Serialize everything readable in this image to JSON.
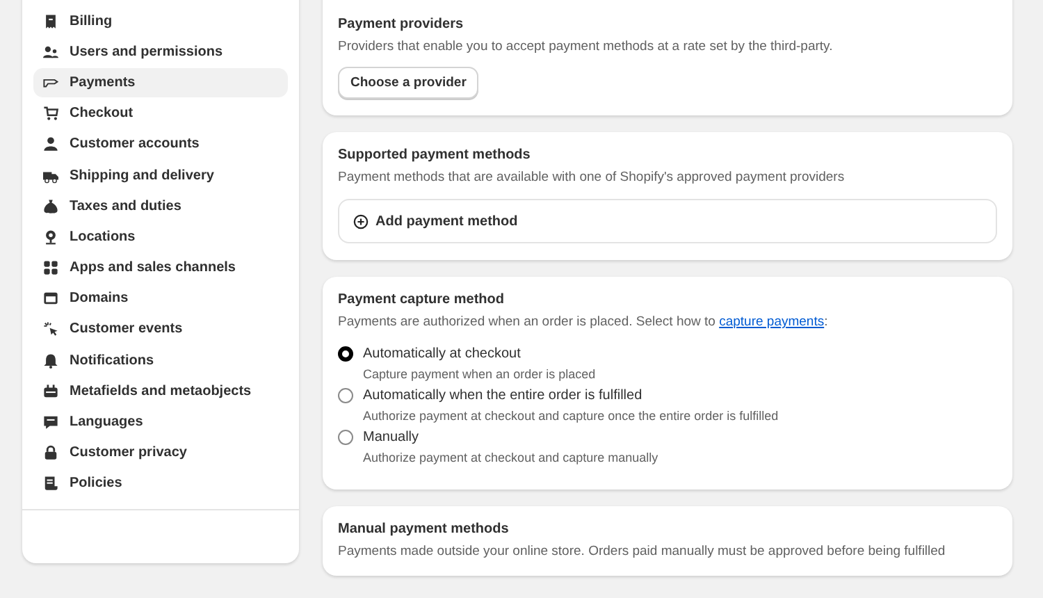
{
  "sidebar": {
    "items": [
      {
        "label": "Billing",
        "selected": false
      },
      {
        "label": "Users and permissions",
        "selected": false
      },
      {
        "label": "Payments",
        "selected": true
      },
      {
        "label": "Checkout",
        "selected": false
      },
      {
        "label": "Customer accounts",
        "selected": false
      },
      {
        "label": "Shipping and delivery",
        "selected": false
      },
      {
        "label": "Taxes and duties",
        "selected": false
      },
      {
        "label": "Locations",
        "selected": false
      },
      {
        "label": "Apps and sales channels",
        "selected": false
      },
      {
        "label": "Domains",
        "selected": false
      },
      {
        "label": "Customer events",
        "selected": false
      },
      {
        "label": "Notifications",
        "selected": false
      },
      {
        "label": "Metafields and metaobjects",
        "selected": false
      },
      {
        "label": "Languages",
        "selected": false
      },
      {
        "label": "Customer privacy",
        "selected": false
      },
      {
        "label": "Policies",
        "selected": false
      }
    ]
  },
  "sections": [
    {
      "kind": "providers",
      "title": "Payment providers",
      "description": "Providers that enable you to accept payment methods at a rate set by the third-party.",
      "button": "Choose a provider"
    },
    {
      "kind": "supported",
      "title": "Supported payment methods",
      "description": "Payment methods that are available with one of Shopify's approved payment providers",
      "button": "Add payment method"
    },
    {
      "kind": "capture",
      "title": "Payment capture method",
      "description": "Payments are authorized when an order is placed. Select how to ",
      "link": "capture payments",
      "after_link": ":",
      "options": [
        {
          "label": "Automatically at checkout",
          "help": "Capture payment when an order is placed",
          "selected": true
        },
        {
          "label": "Automatically when the entire order is fulfilled",
          "help": "Authorize payment at checkout and capture once the entire order is fulfilled",
          "selected": false
        },
        {
          "label": "Manually",
          "help": "Authorize payment at checkout and capture manually",
          "selected": false
        }
      ]
    },
    {
      "kind": "manual",
      "title": "Manual payment methods",
      "description": "Payments made outside your online store. Orders paid manually must be approved before being fulfilled"
    }
  ]
}
